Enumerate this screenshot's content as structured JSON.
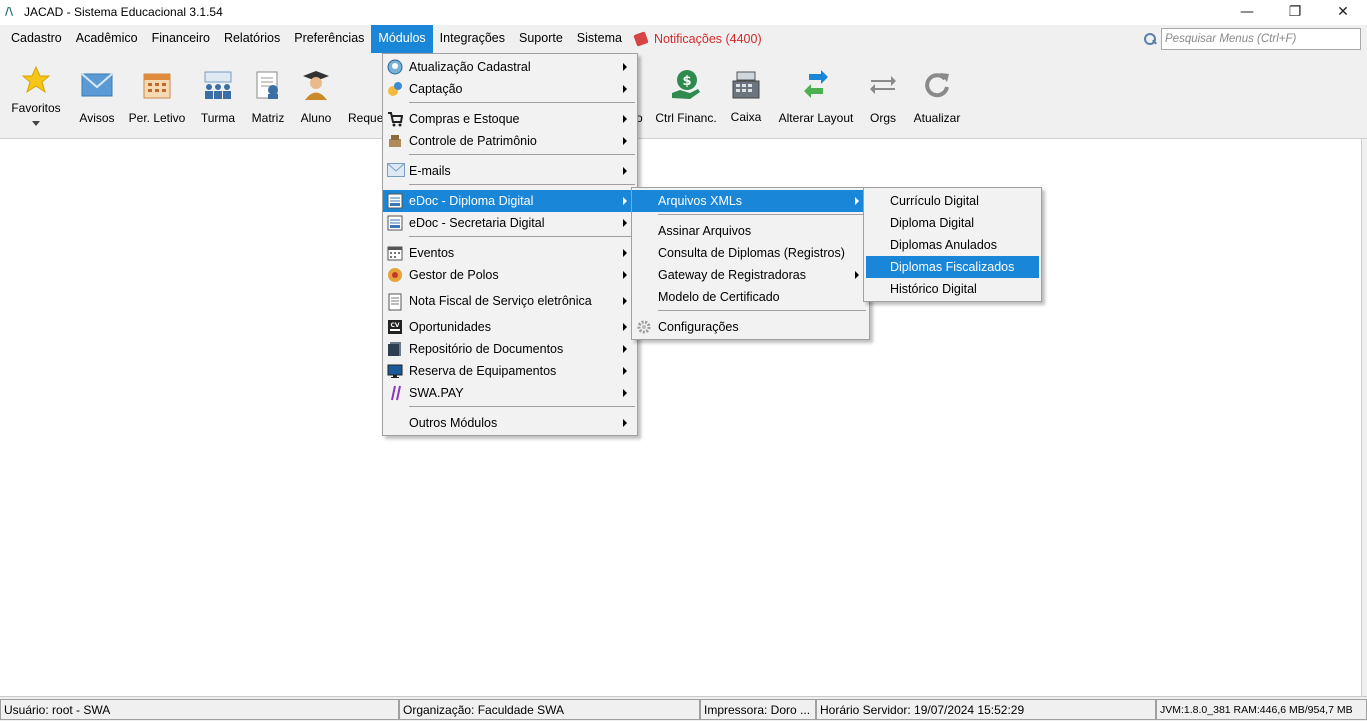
{
  "window": {
    "title": "JACAD - Sistema Educacional 3.1.54",
    "logo": "JACAD logo",
    "minimize_glyph": "—",
    "maximize_glyph": "❐",
    "close_glyph": "✕"
  },
  "menubar": {
    "items": [
      "Cadastro",
      "Acadêmico",
      "Financeiro",
      "Relatórios",
      "Preferências",
      "Módulos",
      "Integrações",
      "Suporte",
      "Sistema"
    ],
    "active": "Módulos",
    "notifications": "Notificações (4400)",
    "search_placeholder": "Pesquisar Menus (Ctrl+F)"
  },
  "toolbar": {
    "buttons": [
      "Favoritos",
      "Avisos",
      "Per. Letivo",
      "Turma",
      "Matriz",
      "Aluno",
      "Reque",
      "o",
      "Ctrl Financ.",
      "Caixa",
      "Alterar Layout",
      "Orgs",
      "Atualizar"
    ]
  },
  "modulos_menu": {
    "items": [
      {
        "label": "Atualização Cadastral",
        "icon": "refresh-user-icon"
      },
      {
        "label": "Captação",
        "icon": "capture-icon"
      },
      {
        "label": "Compras e Estoque",
        "icon": "cart-icon"
      },
      {
        "label": "Controle de Patrimônio",
        "icon": "inventory-icon"
      },
      {
        "label": "E-mails",
        "icon": "envelope-icon"
      },
      {
        "label": "eDoc - Diploma Digital",
        "icon": "document-icon"
      },
      {
        "label": "eDoc - Secretaria Digital",
        "icon": "document-icon"
      },
      {
        "label": "Eventos",
        "icon": "calendar-icon"
      },
      {
        "label": "Gestor de Polos",
        "icon": "hub-icon"
      },
      {
        "label": "Nota Fiscal de Serviço eletrônica",
        "icon": "invoice-icon"
      },
      {
        "label": "Oportunidades",
        "icon": "cv-icon"
      },
      {
        "label": "Repositório de Documentos",
        "icon": "folder-icon"
      },
      {
        "label": "Reserva de Equipamentos",
        "icon": "monitor-icon"
      },
      {
        "label": "SWA.PAY",
        "icon": "swapay-icon"
      },
      {
        "label": "Outros Módulos",
        "icon": ""
      }
    ]
  },
  "diploma_submenu": {
    "items": [
      "Arquivos XMLs",
      "Assinar Arquivos",
      "Consulta de Diplomas (Registros)",
      "Gateway de Registradoras",
      "Modelo de Certificado",
      "Configurações"
    ]
  },
  "xml_submenu": {
    "items": [
      "Currículo Digital",
      "Diploma Digital",
      "Diplomas Anulados",
      "Diplomas Fiscalizados",
      "Histórico Digital"
    ],
    "highlighted": "Diplomas Fiscalizados"
  },
  "statusbar": {
    "usuario": "Usuário: root - SWA",
    "organizacao": "Organização: Faculdade SWA",
    "impressora": "Impressora: Doro ...",
    "horario": "Horário Servidor: 19/07/2024 15:52:29",
    "jvm": "JVM:1.8.0_381  RAM:446,6 MB/954,7 MB"
  },
  "colors": {
    "highlight": "#1a86d8",
    "notification": "#d32a2a"
  }
}
